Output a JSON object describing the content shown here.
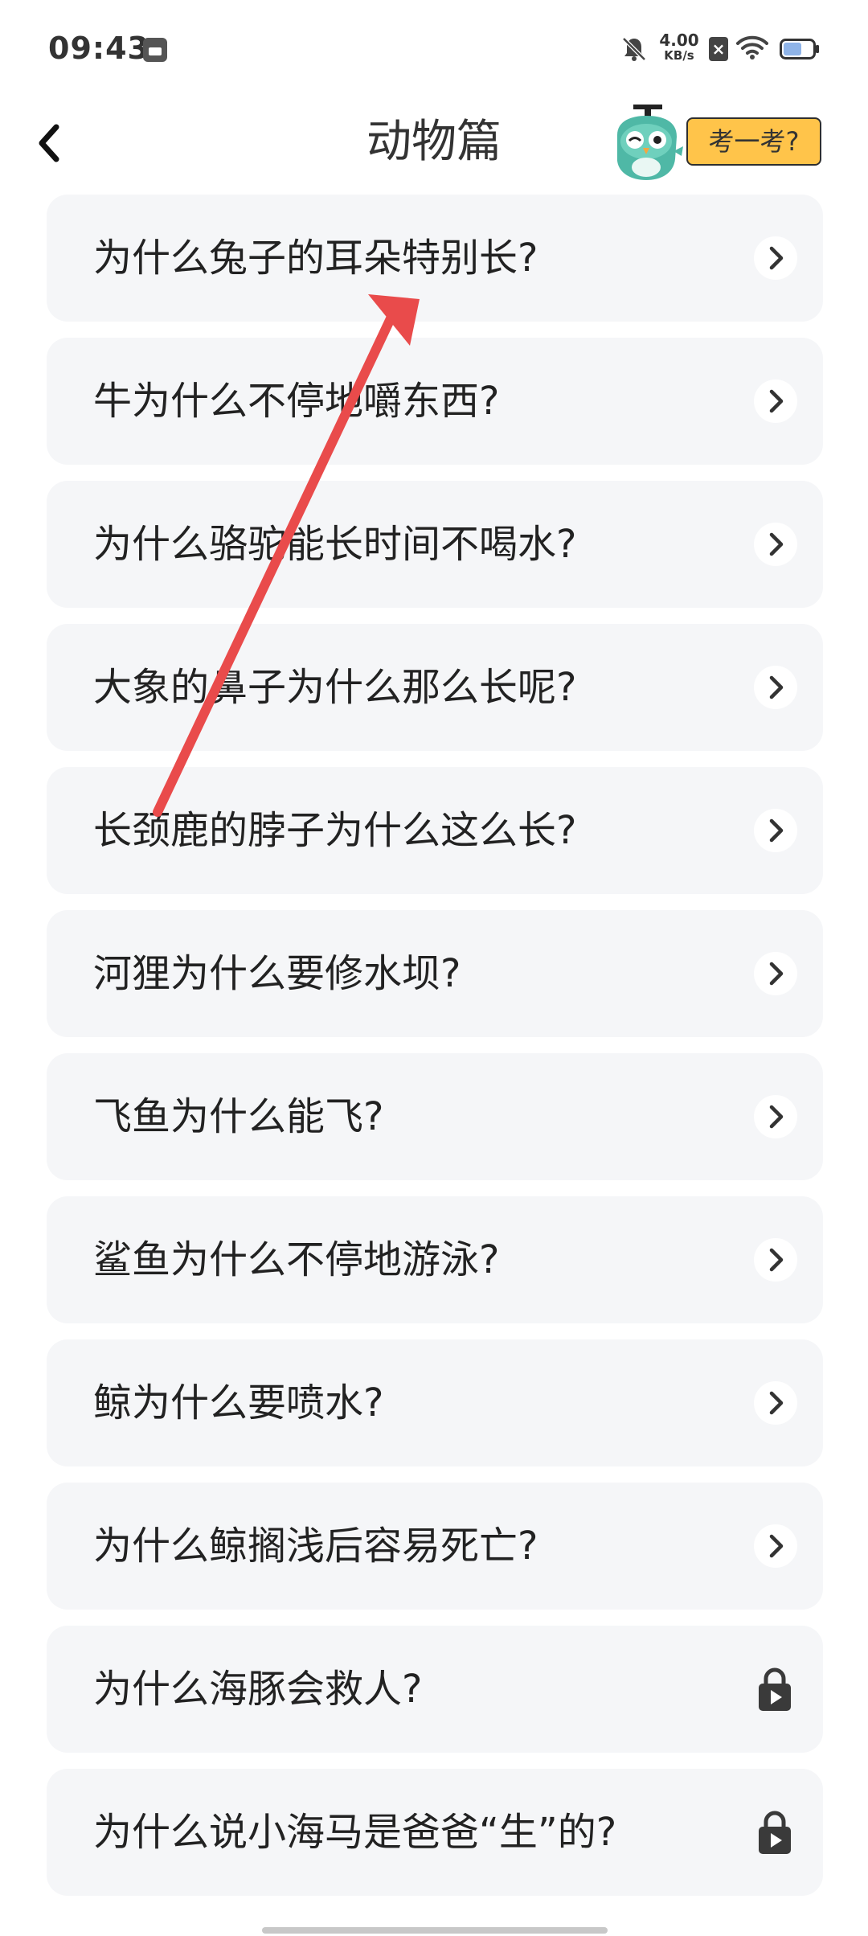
{
  "status_bar": {
    "time": "09:43",
    "network_speed_value": "4.00",
    "network_speed_unit": "KB/s",
    "sim_label": "×",
    "icons": [
      "notification-app-icon",
      "bell-muted-icon",
      "sim-icon",
      "wifi-icon",
      "battery-icon"
    ]
  },
  "header": {
    "title": "动物篇",
    "quiz_label": "考一考?",
    "back_icon": "chevron-left-icon",
    "mascot_icon": "owl-mascot-icon"
  },
  "colors": {
    "quiz_button_bg": "#ffc44a",
    "item_bg": "#f5f6f8",
    "arrow_red": "#e94b4b",
    "text": "#222222"
  },
  "questions": [
    {
      "title": "为什么兔子的耳朵特别长?",
      "status": "open"
    },
    {
      "title": "牛为什么不停地嚼东西?",
      "status": "open"
    },
    {
      "title": "为什么骆驼能长时间不喝水?",
      "status": "open"
    },
    {
      "title": "大象的鼻子为什么那么长呢?",
      "status": "open"
    },
    {
      "title": "长颈鹿的脖子为什么这么长?",
      "status": "open"
    },
    {
      "title": "河狸为什么要修水坝?",
      "status": "open"
    },
    {
      "title": "飞鱼为什么能飞?",
      "status": "open"
    },
    {
      "title": "鲨鱼为什么不停地游泳?",
      "status": "open"
    },
    {
      "title": "鲸为什么要喷水?",
      "status": "open"
    },
    {
      "title": "为什么鲸搁浅后容易死亡?",
      "status": "open"
    },
    {
      "title": "为什么海豚会救人?",
      "status": "locked"
    },
    {
      "title": "为什么说小海马是爸爸“生”的?",
      "status": "locked"
    }
  ]
}
